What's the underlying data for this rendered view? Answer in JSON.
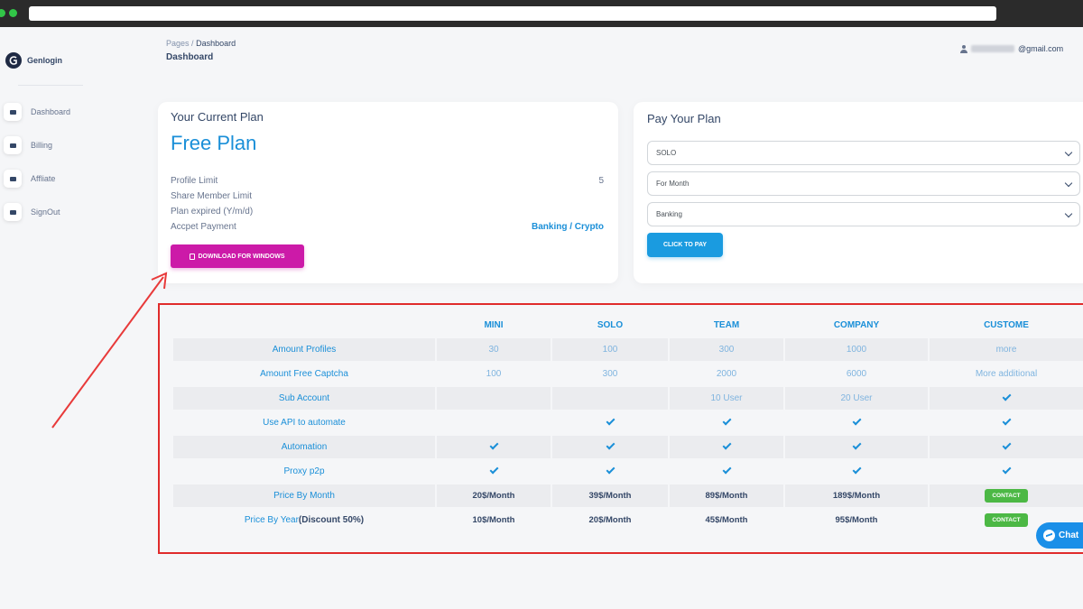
{
  "brand": {
    "name": "Genlogin"
  },
  "sidebar": {
    "items": [
      {
        "label": "Dashboard",
        "icon": "monitor-icon"
      },
      {
        "label": "Billing",
        "icon": "billing-icon"
      },
      {
        "label": "Affliate",
        "icon": "affiliate-icon"
      },
      {
        "label": "SignOut",
        "icon": "signout-icon"
      }
    ]
  },
  "header": {
    "breadcrumb_root": "Pages",
    "breadcrumb_sep": "/",
    "breadcrumb_current": "Dashboard",
    "title": "Dashboard",
    "user_email_suffix": "@gmail.com"
  },
  "plan": {
    "heading": "Your Current Plan",
    "name": "Free Plan",
    "rows": [
      {
        "label": "Profile Limit",
        "value": "5"
      },
      {
        "label": "Share Member Limit",
        "value": ""
      },
      {
        "label": "Plan expired (Y/m/d)",
        "value": ""
      },
      {
        "label": "Accpet Payment",
        "value": "Banking / Crypto"
      }
    ],
    "download_label": "DOWNLOAD FOR WINDOWS"
  },
  "pay": {
    "heading": "Pay Your Plan",
    "plan_select": "SOLO",
    "period_select": "For Month",
    "method_select": "Banking",
    "button_label": "CLICK TO PAY"
  },
  "pricing": {
    "columns": [
      "MINI",
      "SOLO",
      "TEAM",
      "COMPANY",
      "CUSTOME"
    ],
    "rows": [
      {
        "label": "Amount Profiles",
        "cells": [
          "30",
          "100",
          "300",
          "1000",
          "more"
        ]
      },
      {
        "label": "Amount Free Captcha",
        "cells": [
          "100",
          "300",
          "2000",
          "6000",
          "More additional"
        ]
      },
      {
        "label": "Sub Account",
        "cells": [
          "",
          "",
          "10 User",
          "20 User",
          "check"
        ]
      },
      {
        "label": "Use API to automate",
        "cells": [
          "",
          "check",
          "check",
          "check",
          "check"
        ]
      },
      {
        "label": "Automation",
        "cells": [
          "check",
          "check",
          "check",
          "check",
          "check"
        ]
      },
      {
        "label": "Proxy p2p",
        "cells": [
          "check",
          "check",
          "check",
          "check",
          "check"
        ]
      },
      {
        "label": "Price By Month",
        "cells": [
          "20$/Month",
          "39$/Month",
          "89$/Month",
          "189$/Month",
          "CONTACT"
        ]
      },
      {
        "label": "Price By Year",
        "label_suffix": "(Discount 50%)",
        "cells": [
          "10$/Month",
          "20$/Month",
          "45$/Month",
          "95$/Month",
          "CONTACT"
        ]
      }
    ]
  },
  "chat": {
    "label": "Chat"
  },
  "colors": {
    "accent": "#1a8fd8",
    "download_button": "#cc1aa8",
    "pay_button": "#1a9be0",
    "contact_badge": "#4cb845",
    "highlight_frame": "#e02b2b"
  }
}
